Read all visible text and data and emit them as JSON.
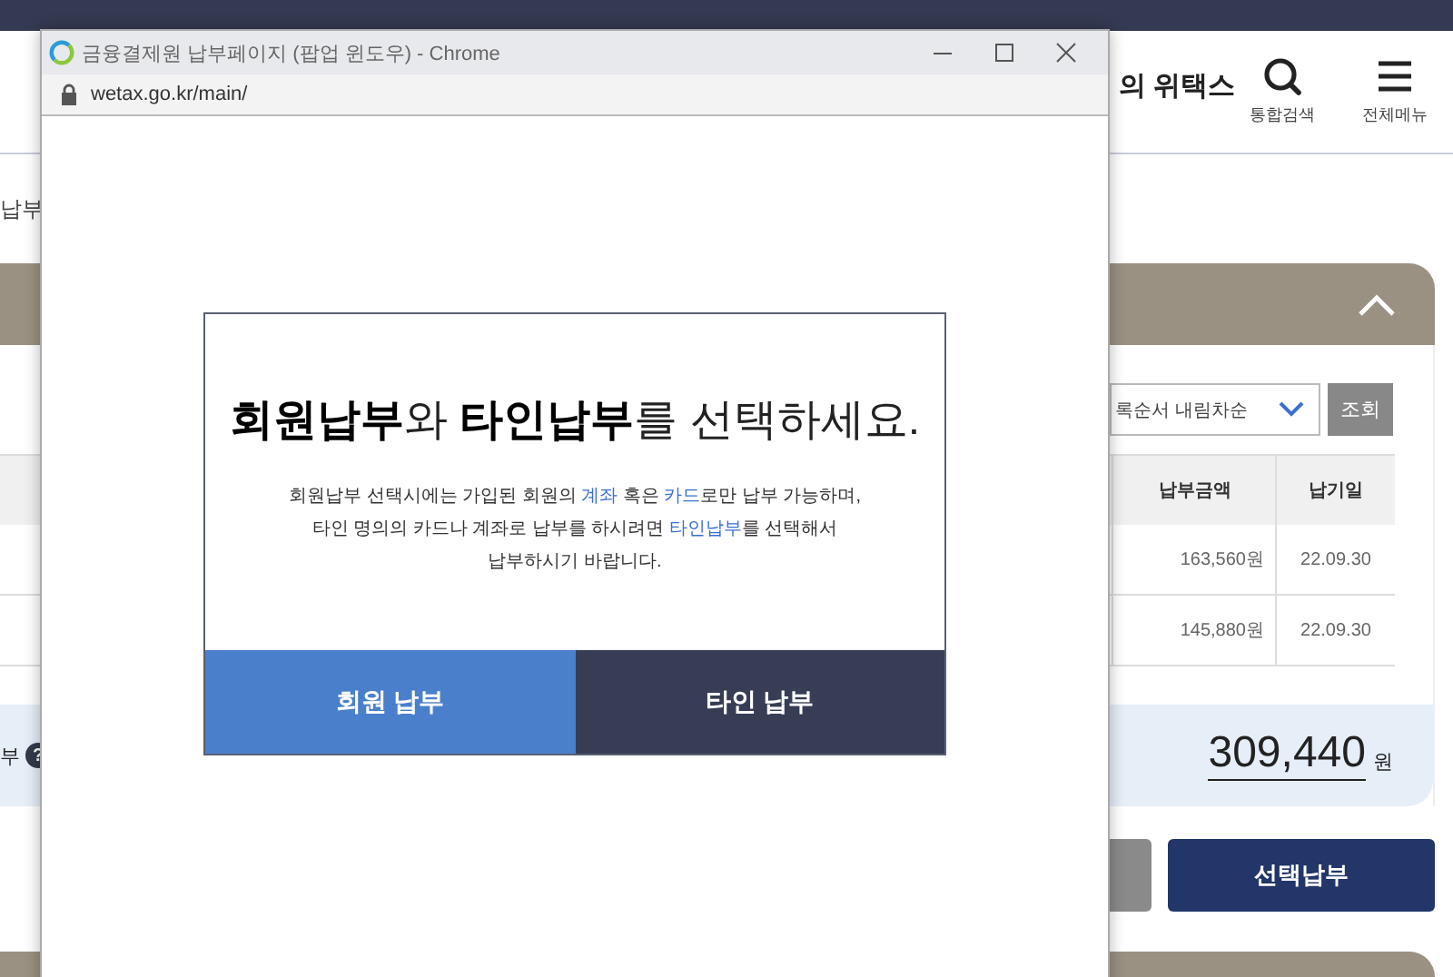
{
  "page": {
    "header_title": "의 위택스",
    "header_actions": [
      {
        "label": "통합검색",
        "kind": "search"
      },
      {
        "label": "전체메뉴",
        "kind": "menu"
      }
    ],
    "breadcrumb": "납부",
    "sort_select": {
      "value": "록순서 내림차순"
    },
    "search_button": "조회",
    "table": {
      "columns": [
        "납부금액",
        "납기일"
      ],
      "rows": [
        [
          "163,560원",
          "22.09.30"
        ],
        [
          "145,880원",
          "22.09.30"
        ]
      ]
    },
    "total": {
      "label": "부",
      "help": "?",
      "amount": "309,440",
      "unit": "원"
    },
    "submit_button": "선택납부"
  },
  "popup": {
    "title": "금융결제원 납부페이지 (팝업 윈도우) - Chrome",
    "url": "wetax.go.kr/main/",
    "dialog": {
      "title": "**회원납부**와 **타인납부**를 선택하세요.",
      "body": [
        [
          {
            "kind": "text",
            "text": "회원납부 선택시에는 가입된 회원의 "
          },
          {
            "kind": "highlight",
            "text": "계좌"
          },
          {
            "kind": "text",
            "text": " 혹은 "
          },
          {
            "kind": "highlight",
            "text": "카드"
          },
          {
            "kind": "text",
            "text": "로만 납부 가능하며,"
          }
        ],
        [
          {
            "kind": "text",
            "text": "타인 명의의 카드나 계좌로 납부를 하시려면 "
          },
          {
            "kind": "highlight",
            "text": "타인납부"
          },
          {
            "kind": "text",
            "text": "를 선택해서"
          }
        ],
        [
          {
            "kind": "text",
            "text": "납부하시기 바랍니다."
          }
        ]
      ],
      "buttons": [
        {
          "label": "회원 납부",
          "kind": "primary"
        },
        {
          "label": "타인 납부",
          "kind": "dark"
        }
      ]
    }
  }
}
